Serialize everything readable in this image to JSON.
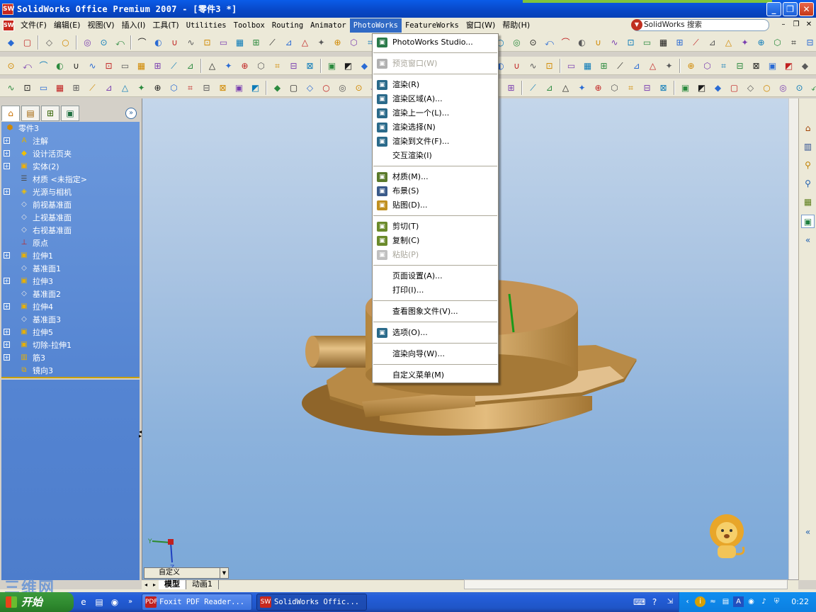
{
  "window": {
    "title": "SolidWorks Office Premium 2007 - [零件3 *]",
    "controls": {
      "minimize": "_",
      "restore": "❐",
      "close": "✕"
    }
  },
  "menubar": {
    "items": [
      {
        "label": "文件(F)",
        "active": false
      },
      {
        "label": "编辑(E)",
        "active": false
      },
      {
        "label": "视图(V)",
        "active": false
      },
      {
        "label": "插入(I)",
        "active": false
      },
      {
        "label": "工具(T)",
        "active": false
      },
      {
        "label": "Utilities",
        "active": false
      },
      {
        "label": "Toolbox",
        "active": false
      },
      {
        "label": "Routing",
        "active": false
      },
      {
        "label": "Animator",
        "active": false
      },
      {
        "label": "PhotoWorks",
        "active": true
      },
      {
        "label": "FeatureWorks",
        "active": false
      },
      {
        "label": "窗口(W)",
        "active": false
      },
      {
        "label": "帮助(H)",
        "active": false
      }
    ],
    "search_label": "SolidWorks 搜索"
  },
  "photoworks_menu": {
    "items": [
      {
        "label": "PhotoWorks Studio...",
        "icon": "studio-icon",
        "disabled": false
      },
      {
        "sep": true
      },
      {
        "label": "预览窗口(W)",
        "icon": "preview-window-icon",
        "disabled": true
      },
      {
        "sep": true
      },
      {
        "label": "渲染(R)",
        "icon": "render-icon",
        "disabled": false
      },
      {
        "label": "渲染区域(A)...",
        "icon": "render-area-icon",
        "disabled": false
      },
      {
        "label": "渲染上一个(L)...",
        "icon": "render-last-icon",
        "disabled": false
      },
      {
        "label": "渲染选择(N)",
        "icon": "render-selection-icon",
        "disabled": false
      },
      {
        "label": "渲染到文件(F)...",
        "icon": "render-to-file-icon",
        "disabled": false
      },
      {
        "label": "交互渲染(I)",
        "icon": "",
        "disabled": false
      },
      {
        "sep": true
      },
      {
        "label": "材质(M)...",
        "icon": "material-icon",
        "disabled": false
      },
      {
        "label": "布景(S)",
        "icon": "scene-icon",
        "disabled": false
      },
      {
        "label": "贴图(D)...",
        "icon": "decal-icon",
        "disabled": false
      },
      {
        "sep": true
      },
      {
        "label": "剪切(T)",
        "icon": "cut-icon",
        "disabled": false
      },
      {
        "label": "复制(C)",
        "icon": "copy-icon",
        "disabled": false
      },
      {
        "label": "粘贴(P)",
        "icon": "paste-icon",
        "disabled": true
      },
      {
        "sep": true
      },
      {
        "label": "页面设置(A)...",
        "icon": "",
        "disabled": false
      },
      {
        "label": "打印(I)...",
        "icon": "",
        "disabled": false
      },
      {
        "sep": true
      },
      {
        "label": "查看图象文件(V)...",
        "icon": "",
        "disabled": false
      },
      {
        "sep": true
      },
      {
        "label": "选项(O)...",
        "icon": "options-icon",
        "disabled": false
      },
      {
        "sep": true
      },
      {
        "label": "渲染向导(W)...",
        "icon": "",
        "disabled": false
      },
      {
        "sep": true
      },
      {
        "label": "自定义菜单(M)",
        "icon": "",
        "disabled": false
      }
    ]
  },
  "feature_tree": {
    "root": "零件3",
    "items": [
      {
        "label": "注解",
        "icon": "annotation-icon",
        "expandable": true
      },
      {
        "label": "设计活页夹",
        "icon": "design-binder-icon",
        "expandable": true
      },
      {
        "label": "实体(2)",
        "icon": "solid-bodies-icon",
        "expandable": true
      },
      {
        "label": "材质 <未指定>",
        "icon": "material-icon",
        "expandable": false
      },
      {
        "label": "光源与相机",
        "icon": "lights-cameras-icon",
        "expandable": true
      },
      {
        "label": "前视基准面",
        "icon": "plane-icon",
        "expandable": false
      },
      {
        "label": "上视基准面",
        "icon": "plane-icon",
        "expandable": false
      },
      {
        "label": "右视基准面",
        "icon": "plane-icon",
        "expandable": false
      },
      {
        "label": "原点",
        "icon": "origin-icon",
        "expandable": false
      },
      {
        "label": "拉伸1",
        "icon": "extrude-icon",
        "expandable": true
      },
      {
        "label": "基准面1",
        "icon": "plane-icon",
        "expandable": false
      },
      {
        "label": "拉伸3",
        "icon": "extrude-icon",
        "expandable": true
      },
      {
        "label": "基准面2",
        "icon": "plane-icon",
        "expandable": false
      },
      {
        "label": "拉伸4",
        "icon": "extrude-icon",
        "expandable": true
      },
      {
        "label": "基准面3",
        "icon": "plane-icon",
        "expandable": false
      },
      {
        "label": "拉伸5",
        "icon": "extrude-icon",
        "expandable": true
      },
      {
        "label": "切除-拉伸1",
        "icon": "cut-extrude-icon",
        "expandable": true
      },
      {
        "label": "筋3",
        "icon": "rib-icon",
        "expandable": true
      },
      {
        "label": "镜向3",
        "icon": "mirror-icon",
        "expandable": false
      }
    ]
  },
  "viewport": {
    "configuration": "自定义",
    "tabs": [
      "模型",
      "动画1"
    ],
    "triad": {
      "y": "Y",
      "z": "Z"
    }
  },
  "taskbar": {
    "start_label": "开始",
    "tasks": [
      {
        "label": "Foxit PDF Reader...",
        "active": false
      },
      {
        "label": "SolidWorks Offic...",
        "active": true
      }
    ],
    "clock": "0:22",
    "watermark": "三维网"
  }
}
